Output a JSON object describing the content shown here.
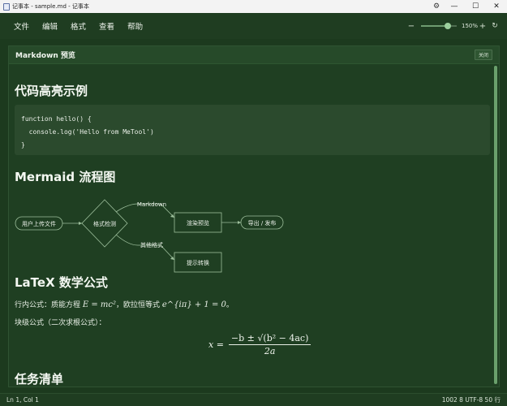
{
  "window": {
    "title": "记事本 - sample.md - 记事本"
  },
  "menu": {
    "items": [
      "文件",
      "编辑",
      "格式",
      "查看",
      "帮助"
    ],
    "zoom_minus": "−",
    "zoom_plus": "+",
    "zoom_label": "150%",
    "zoom_level_fraction": 0.75
  },
  "preview": {
    "title": "Markdown 预览",
    "close_label": "关闭",
    "sections": {
      "code_title": "代码高亮示例",
      "code_lines": [
        "function hello() {",
        "  console.log('Hello from MeTool')",
        "}"
      ],
      "mermaid_title": "Mermaid 流程图",
      "flow": {
        "start": "用户上传文件",
        "decision": "格式检测",
        "render": "渲染预览",
        "export": "导出 / 发布",
        "prompt": "提示转换",
        "edge_markdown": "Markdown",
        "edge_other": "其他格式"
      },
      "latex_title": "LaTeX 数学公式",
      "inline_prefix": "行内公式：质能方程 ",
      "inline_formula1": "E = mc²",
      "inline_middle": "，欧拉恒等式 ",
      "inline_formula2": "e^{iπ} + 1 = 0",
      "inline_suffix": "。",
      "block_label": "块级公式（二次求根公式）：",
      "block_lhs": "x =",
      "block_num": "−b ± √(b² − 4ac)",
      "block_den": "2a",
      "tasks_title": "任务清单"
    }
  },
  "status": {
    "position": "Ln 1, Col 1",
    "info": "1002 8 UTF-8 50 行"
  },
  "colors": {
    "background": "#1c3a1e",
    "panel": "#1f3f22",
    "accent": "#6aa06c"
  }
}
